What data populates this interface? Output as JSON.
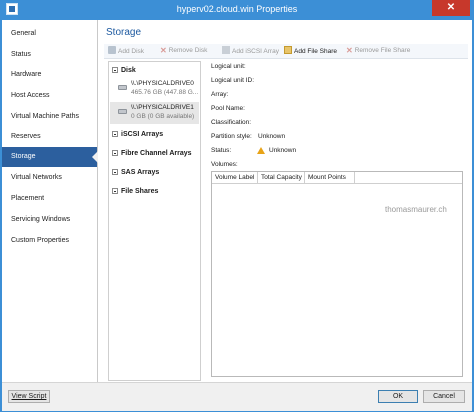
{
  "window": {
    "title": "hyperv02.cloud.win Properties",
    "close_glyph": "✕"
  },
  "nav": {
    "items": [
      {
        "label": "General",
        "active": false
      },
      {
        "label": "Status",
        "active": false
      },
      {
        "label": "Hardware",
        "active": false
      },
      {
        "label": "Host Access",
        "active": false
      },
      {
        "label": "Virtual Machine Paths",
        "active": false
      },
      {
        "label": "Reserves",
        "active": false
      },
      {
        "label": "Storage",
        "active": true
      },
      {
        "label": "Virtual Networks",
        "active": false
      },
      {
        "label": "Placement",
        "active": false
      },
      {
        "label": "Servicing Windows",
        "active": false
      },
      {
        "label": "Custom Properties",
        "active": false
      }
    ]
  },
  "main": {
    "section_title": "Storage",
    "toolbar": {
      "add_disk": "Add Disk",
      "remove_disk": "Remove Disk",
      "add_iscsi": "Add iSCSI Array",
      "add_file_share": "Add File Share",
      "remove_file_share": "Remove File Share"
    },
    "tree": {
      "disk_label": "Disk",
      "drives": [
        {
          "name": "\\\\.\\PHYSICALDRIVE0",
          "size": "465.76 GB (447.88 G..."
        },
        {
          "name": "\\\\.\\PHYSICALDRIVE1",
          "size": "0 GB (0 GB available)"
        }
      ],
      "iscsi_label": "iSCSI Arrays",
      "fc_label": "Fibre Channel Arrays",
      "sas_label": "SAS Arrays",
      "fileshares_label": "File Shares"
    },
    "properties": {
      "logical_unit": "Logical unit:",
      "logical_unit_id": "Logical unit ID:",
      "array": "Array:",
      "pool_name": "Pool Name:",
      "classification": "Classification:",
      "partition_style_label": "Partition style:",
      "partition_style_value": "Unknown",
      "status_label": "Status:",
      "status_value": "Unknown",
      "volumes_label": "Volumes:"
    },
    "volumes_table": {
      "columns": [
        "Volume Label",
        "Total Capacity",
        "Mount Points"
      ]
    },
    "watermark": "thomasmaurer.ch"
  },
  "footer": {
    "view_script": "View Script",
    "ok": "OK",
    "cancel": "Cancel"
  },
  "colors": {
    "accent": "#2c5f9e",
    "title_bar": "#3c8fd6",
    "warning": "#e8a317"
  },
  "icons": {
    "warning": "warning-icon",
    "disk": "disk-icon",
    "remove": "remove-icon",
    "file_share": "file-share-icon"
  }
}
